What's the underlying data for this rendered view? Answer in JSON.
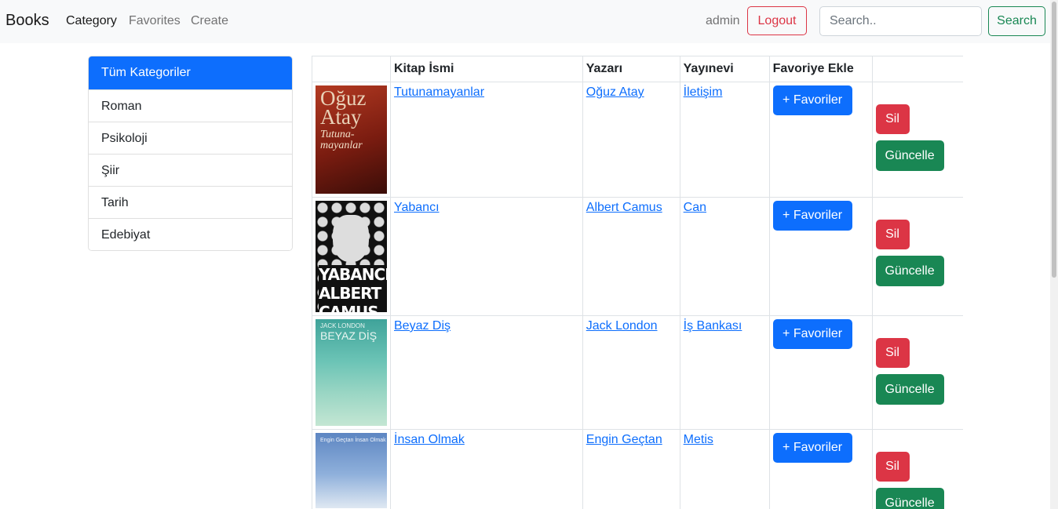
{
  "navbar": {
    "brand": "Books",
    "links": [
      {
        "label": "Category"
      },
      {
        "label": "Favorites"
      },
      {
        "label": "Create"
      }
    ],
    "user": "admin",
    "logout_label": "Logout",
    "search_placeholder": "Search..",
    "search_label": "Search"
  },
  "categories": [
    {
      "label": "Tüm Kategoriler",
      "active": true
    },
    {
      "label": "Roman"
    },
    {
      "label": "Psikoloji"
    },
    {
      "label": "Şiir"
    },
    {
      "label": "Tarih"
    },
    {
      "label": "Edebiyat"
    }
  ],
  "table": {
    "headers": [
      "",
      "Kitap İsmi",
      "Yazarı",
      "Yayınevi",
      "Favoriye Ekle",
      ""
    ],
    "rows": [
      {
        "title": "Tutunamayanlar",
        "author": "Oğuz Atay",
        "publisher": "İletişim",
        "cover": {
          "line1": "Oğuz Atay",
          "line2": "Tutuna-mayanlar"
        }
      },
      {
        "title": "Yabancı",
        "author": "Albert Camus",
        "publisher": "Can",
        "cover": {
          "line1": "YABANCI ALBERT CAMUS",
          "line2": ""
        }
      },
      {
        "title": "Beyaz Diş",
        "author": "Jack London",
        "publisher": "İş Bankası",
        "cover": {
          "line1": "JACK LONDON",
          "line2": "BEYAZ DİŞ"
        }
      },
      {
        "title": "İnsan Olmak",
        "author": "Engin Geçtan",
        "publisher": "Metis",
        "cover": {
          "line1": "Engin Geçtan İnsan Olmak",
          "line2": ""
        }
      }
    ],
    "favorite_label": "+ Favoriler",
    "delete_label": "Sil",
    "update_label": "Güncelle"
  },
  "colors": {
    "primary": "#0d6efd",
    "danger": "#dc3545",
    "success": "#198754",
    "navbar_bg": "#f8f9fa"
  }
}
